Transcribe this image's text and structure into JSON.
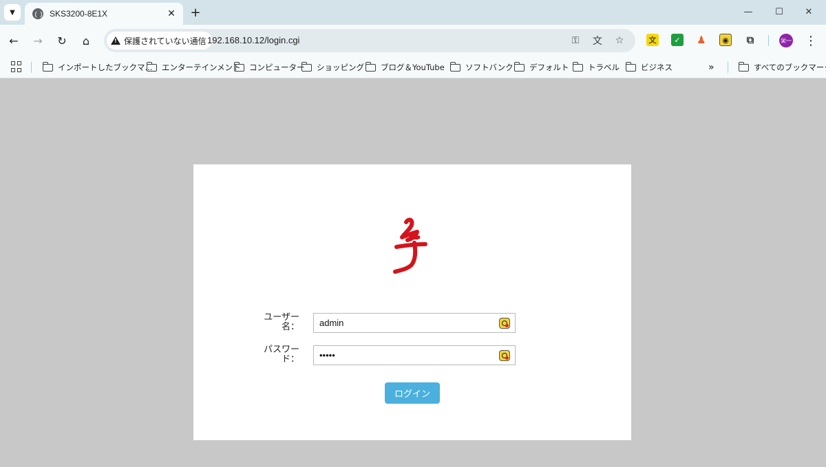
{
  "browser": {
    "tab": {
      "title": "SKS3200-8E1X"
    },
    "address_bar": {
      "security_label": "保護されていない通信",
      "url": "192.168.10.12/login.cgi"
    },
    "bookmarks": [
      {
        "label": "インポートしたブックマ..."
      },
      {
        "label": "エンターテインメント"
      },
      {
        "label": "コンピューター"
      },
      {
        "label": "ショッピング"
      },
      {
        "label": "ブログ＆YouTube"
      },
      {
        "label": "ソフトバンク"
      },
      {
        "label": "デフォルト"
      },
      {
        "label": "トラベル"
      },
      {
        "label": "ビジネス"
      }
    ],
    "overflow_label": "»",
    "all_bookmarks_label": "すべてのブックマーク",
    "profile_initials": "栄一"
  },
  "login": {
    "username": {
      "label_line1": "ユーザー",
      "label_line2": "名：",
      "value": "admin"
    },
    "password": {
      "label_line1": "パスワー",
      "label_line2": "ド：",
      "value": "•••••"
    },
    "submit_label": "ログイン"
  },
  "colors": {
    "page_background": "#c8c8c8",
    "card": "#ffffff",
    "button": "#4bb0de",
    "logo": "#d4141c"
  }
}
